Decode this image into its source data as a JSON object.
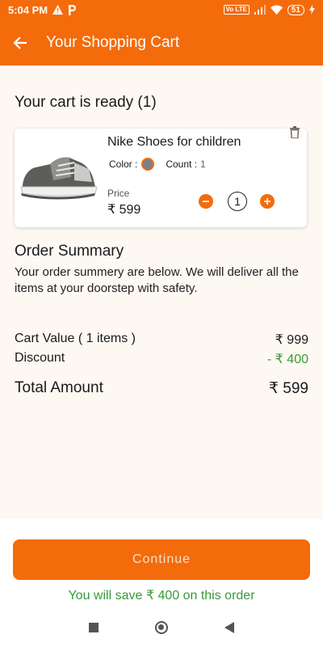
{
  "status_bar": {
    "time": "5:04 PM",
    "left_icons": [
      "warning-icon",
      "parking-icon"
    ],
    "network_badge": "Vo LTE",
    "battery": "51"
  },
  "app_bar": {
    "title": "Your Shopping Cart",
    "back_icon": "arrow-left-icon"
  },
  "cart": {
    "heading": "Your cart is ready (1)",
    "items": [
      {
        "name": "Nike Shoes for children",
        "color_label": "Color :",
        "color_swatch": "#7f7f8a",
        "count_label": "Count :",
        "count_value": "1",
        "price_label": "Price",
        "price": "₹ 599",
        "quantity": "1"
      }
    ]
  },
  "summary": {
    "title": "Order Summary",
    "description": "Your order summery are below. We will deliver all the items at your doorstep with safety.",
    "cart_value_label": "Cart Value ( 1 items )",
    "cart_value": "₹ 999",
    "discount_label": "Discount",
    "discount_value": "- ₹ 400",
    "total_label": "Total Amount",
    "total_value": "₹ 599"
  },
  "footer": {
    "continue_label": "Continue",
    "save_text": "You will save ₹ 400 on this order"
  },
  "colors": {
    "accent": "#f46b0b",
    "success": "#3a9a3a",
    "background": "#fdf8f2"
  }
}
